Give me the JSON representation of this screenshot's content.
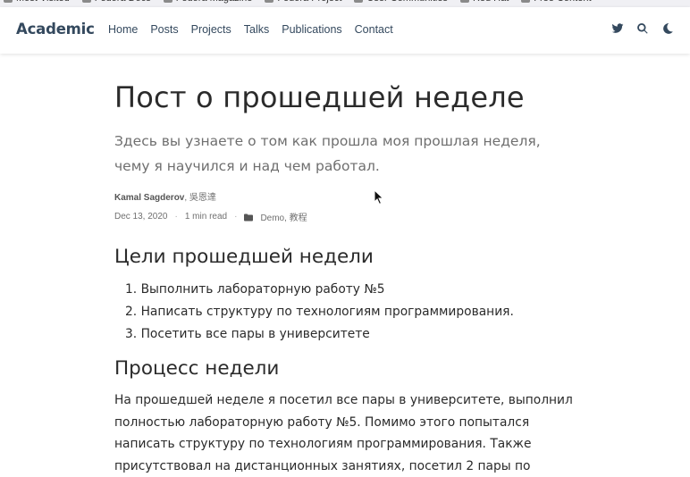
{
  "browser": {
    "bookmarks": [
      "Most Visited",
      "Fedora Docs",
      "Fedora Magazine",
      "Fedora Project",
      "User Communities",
      "Red Hat",
      "Free Content"
    ],
    "more_label": "»"
  },
  "navbar": {
    "brand": "Academic",
    "links": [
      "Home",
      "Posts",
      "Projects",
      "Talks",
      "Publications",
      "Contact"
    ],
    "icons": [
      "twitter-icon",
      "search-icon",
      "moon-icon"
    ]
  },
  "article": {
    "title": "Пост о прошедшей неделе",
    "subtitle": "Здесь вы узнаете о том как прошла моя прошлая неделя, чему я научился и над чем работал.",
    "meta": {
      "author_main": "Kamal Sagderov",
      "author_rest": ", 吳恩達",
      "date": "Dec 13, 2020",
      "read_time": "1 min read",
      "categories": "Demo, 教程",
      "separator": "·"
    },
    "goals_heading": "Цели прошедшей недели",
    "goals": [
      "Выполнить лабораторную работу №5",
      "Написать структуру по технологиям программирования.",
      "Посетить все пары в университете"
    ],
    "process_heading": "Процесс недели",
    "process_text": "На прошедшей неделе я посетил все пары в университете, выполнил полностью лабораторную работу №5. Помимо этого попытался написать структуру по технологиям программирования. Также присутствовал на дистанционных занятиях, посетил 2 пары по"
  },
  "colors": {
    "nav_text": "#34495e",
    "heading_text": "#2b2b2b",
    "subtitle_text": "#6f6f6f"
  }
}
